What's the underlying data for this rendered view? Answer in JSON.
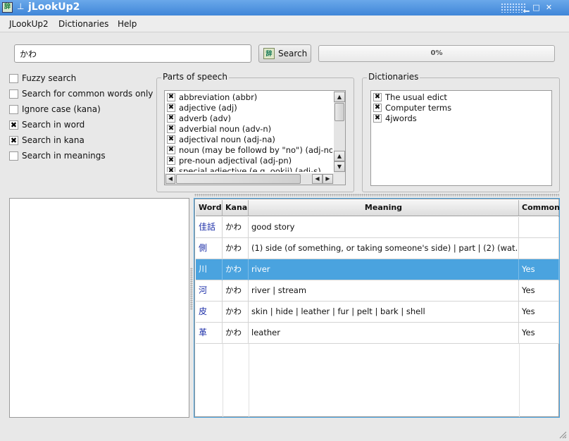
{
  "window": {
    "title": "jLookUp2",
    "app_icon": "dictionary-app-icon"
  },
  "menu": [
    "JLookUp2",
    "Dictionaries",
    "Help"
  ],
  "search": {
    "query": "かわ",
    "button_label": "Search",
    "progress_text": "0%",
    "progress": 0
  },
  "options": [
    {
      "label": "Fuzzy search",
      "checked": false
    },
    {
      "label": "Search for common words only",
      "checked": false
    },
    {
      "label": "Ignore case (kana)",
      "checked": false
    },
    {
      "label": "Search in word",
      "checked": true
    },
    {
      "label": "Search in kana",
      "checked": true
    },
    {
      "label": "Search in meanings",
      "checked": false
    }
  ],
  "parts_of_speech": {
    "title": "Parts of speech",
    "items": [
      {
        "label": "abbreviation (abbr)",
        "checked": true
      },
      {
        "label": "adjective (adj)",
        "checked": true
      },
      {
        "label": "adverb (adv)",
        "checked": true
      },
      {
        "label": "adverbial noun (adv-n)",
        "checked": true
      },
      {
        "label": "adjectival noun (adj-na)",
        "checked": true
      },
      {
        "label": "noun (may be followd by \"no\") (adj-no)",
        "checked": true
      },
      {
        "label": "pre-noun adjectival (adj-pn)",
        "checked": true
      },
      {
        "label": "special adjective (e.g. ookii) (adj-s)",
        "checked": true
      }
    ]
  },
  "dictionaries": {
    "title": "Dictionaries",
    "items": [
      {
        "label": "The usual edict",
        "checked": true
      },
      {
        "label": "Computer terms",
        "checked": true
      },
      {
        "label": "4jwords",
        "checked": true
      }
    ]
  },
  "results": {
    "columns": [
      "Word",
      "Kana",
      "Meaning",
      "Common"
    ],
    "rows": [
      {
        "word": "佳話",
        "kana": "かわ",
        "meaning": "good story",
        "common": "",
        "selected": false
      },
      {
        "word": "側",
        "kana": "かわ",
        "meaning": "(1) side (of something, or taking someone's side) | part | (2) (wat...",
        "common": "",
        "selected": false
      },
      {
        "word": "川",
        "kana": "かわ",
        "meaning": "river",
        "common": "Yes",
        "selected": true
      },
      {
        "word": "河",
        "kana": "かわ",
        "meaning": "river | stream",
        "common": "Yes",
        "selected": false
      },
      {
        "word": "皮",
        "kana": "かわ",
        "meaning": "skin | hide | leather | fur | pelt | bark | shell",
        "common": "Yes",
        "selected": false
      },
      {
        "word": "革",
        "kana": "かわ",
        "meaning": "leather",
        "common": "Yes",
        "selected": false
      }
    ]
  },
  "colors": {
    "titlebar": "#4a8fe0",
    "selection": "#4aa3df",
    "word_link": "#1d2fa8"
  }
}
